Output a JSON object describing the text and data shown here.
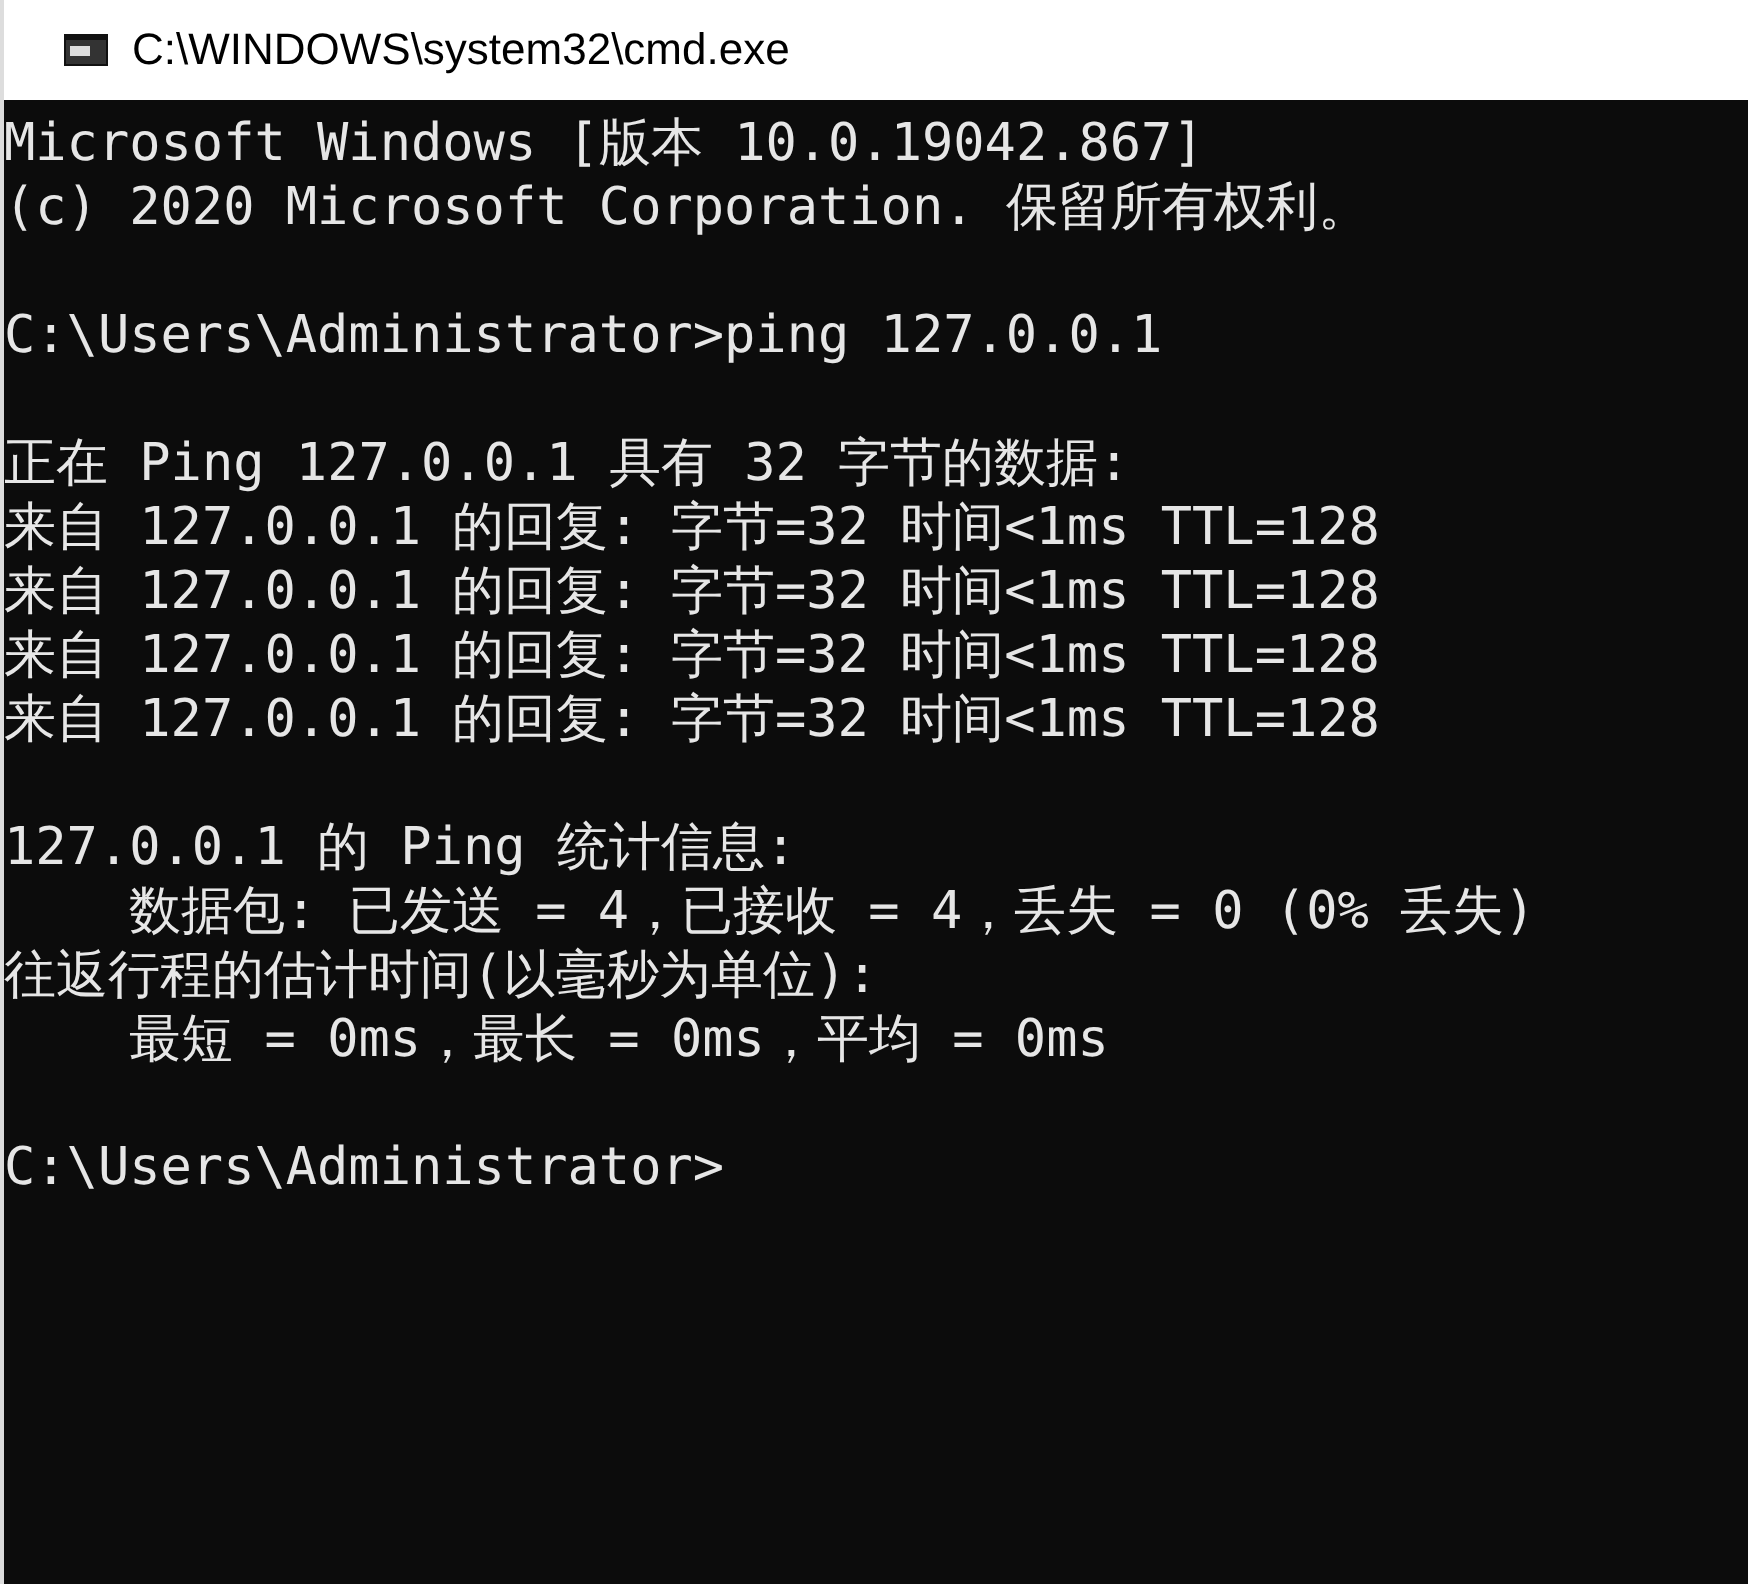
{
  "window": {
    "title": "C:\\WINDOWS\\system32\\cmd.exe"
  },
  "console": {
    "blocks": [
      [
        "Microsoft Windows [版本 10.0.19042.867]",
        "(c) 2020 Microsoft Corporation. 保留所有权利。"
      ],
      [
        "C:\\Users\\Administrator>ping 127.0.0.1"
      ],
      [
        "正在 Ping 127.0.0.1 具有 32 字节的数据:",
        "来自 127.0.0.1 的回复: 字节=32 时间<1ms TTL=128",
        "来自 127.0.0.1 的回复: 字节=32 时间<1ms TTL=128",
        "来自 127.0.0.1 的回复: 字节=32 时间<1ms TTL=128",
        "来自 127.0.0.1 的回复: 字节=32 时间<1ms TTL=128"
      ],
      [
        "127.0.0.1 的 Ping 统计信息:",
        "    数据包: 已发送 = 4，已接收 = 4，丢失 = 0 (0% 丢失)",
        "往返行程的估计时间(以毫秒为单位):",
        "    最短 = 0ms，最长 = 0ms，平均 = 0ms"
      ],
      [
        "C:\\Users\\Administrator>"
      ]
    ]
  }
}
